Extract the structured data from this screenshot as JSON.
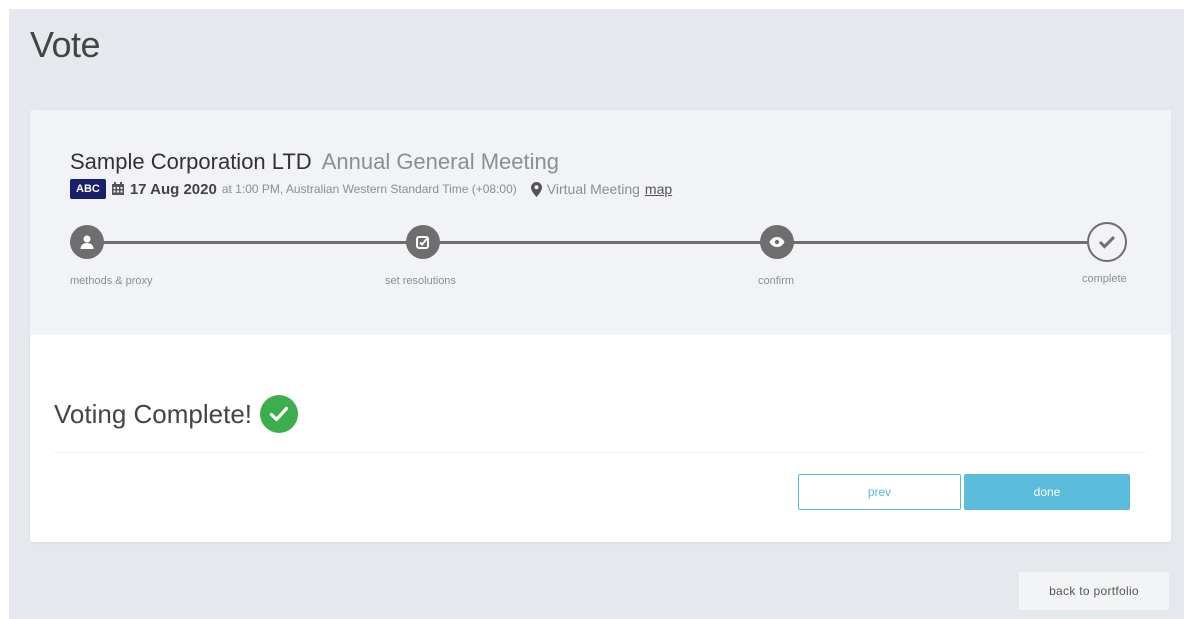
{
  "page": {
    "title": "Vote"
  },
  "meeting": {
    "company": "Sample Corporation LTD",
    "type": "Annual General Meeting",
    "ticker": "ABC",
    "date": "17 Aug 2020",
    "time_info": "at 1:00 PM, Australian Western Standard Time (+08:00)",
    "location": "Virtual Meeting",
    "map_label": "map"
  },
  "steps": [
    {
      "label": "methods & proxy",
      "icon": "user-icon"
    },
    {
      "label": "set resolutions",
      "icon": "checkbox-edit-icon"
    },
    {
      "label": "confirm",
      "icon": "eye-icon"
    },
    {
      "label": "complete",
      "icon": "check-icon"
    }
  ],
  "result": {
    "title": "Voting Complete!"
  },
  "buttons": {
    "prev": "prev",
    "done": "done",
    "back": "back to portfolio"
  },
  "colors": {
    "accent": "#5bbcdc",
    "success": "#3dae4c",
    "ticker_bg": "#1a1f6b",
    "step": "#6e6e6e"
  }
}
